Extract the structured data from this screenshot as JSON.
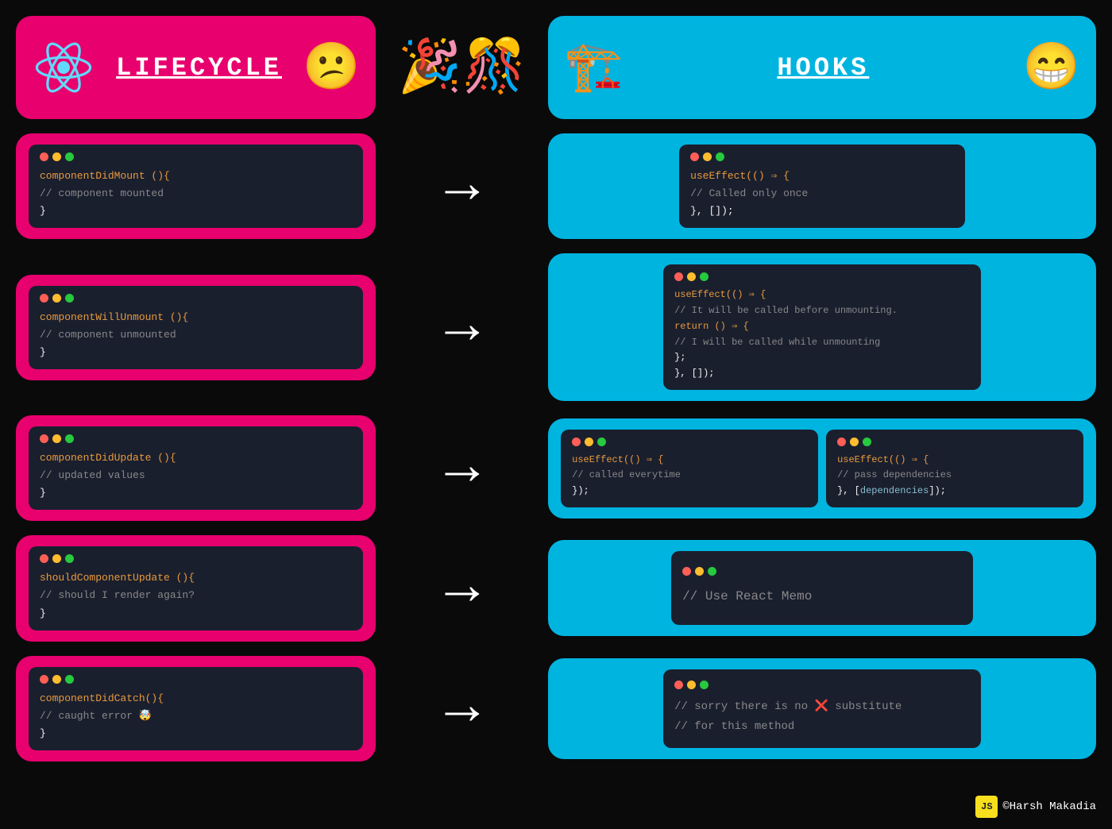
{
  "header": {
    "left": {
      "title": "LIFECYCLE",
      "emoji": "😕"
    },
    "right": {
      "title": "HOOKS",
      "emoji": "😁"
    }
  },
  "codeBlocks": {
    "left": [
      {
        "id": "componentDidMount",
        "lines": [
          {
            "type": "method",
            "text": "componentDidMount (){"
          },
          {
            "type": "comment",
            "text": "    // component mounted"
          },
          {
            "type": "plain",
            "text": "}"
          }
        ]
      },
      {
        "id": "componentWillUnmount",
        "lines": [
          {
            "type": "method",
            "text": "componentWillUnmount (){"
          },
          {
            "type": "comment",
            "text": "    // component unmounted"
          },
          {
            "type": "plain",
            "text": "}"
          }
        ]
      },
      {
        "id": "componentDidUpdate",
        "lines": [
          {
            "type": "method",
            "text": "componentDidUpdate (){"
          },
          {
            "type": "comment",
            "text": "    // updated values"
          },
          {
            "type": "plain",
            "text": "}"
          }
        ]
      },
      {
        "id": "shouldComponentUpdate",
        "lines": [
          {
            "type": "method",
            "text": "shouldComponentUpdate (){"
          },
          {
            "type": "comment",
            "text": "    // should I render again?"
          },
          {
            "type": "plain",
            "text": "}"
          }
        ]
      },
      {
        "id": "componentDidCatch",
        "lines": [
          {
            "type": "method",
            "text": "componentDidCatch(){"
          },
          {
            "type": "comment",
            "text": "    // caught error 🤯"
          },
          {
            "type": "plain",
            "text": "}"
          }
        ]
      }
    ],
    "right": [
      {
        "id": "useEffect-mount",
        "single": true,
        "lines": [
          {
            "type": "method",
            "text": "useEffect(() ⇒ {"
          },
          {
            "type": "comment",
            "text": "    // Called only once"
          },
          {
            "type": "plain",
            "text": "}, []);"
          }
        ]
      },
      {
        "id": "useEffect-unmount",
        "single": true,
        "lines": [
          {
            "type": "method",
            "text": "useEffect(() ⇒ {"
          },
          {
            "type": "comment",
            "text": "    // It will be called before unmounting."
          },
          {
            "type": "plain",
            "text": "    return () ⇒ {"
          },
          {
            "type": "comment",
            "text": "      // I will be called while unmounting"
          },
          {
            "type": "plain",
            "text": "    };"
          },
          {
            "type": "plain",
            "text": "}, []);"
          }
        ]
      },
      {
        "id": "useEffect-update",
        "single": false,
        "left_lines": [
          {
            "type": "method",
            "text": "useEffect(() ⇒ {"
          },
          {
            "type": "comment",
            "text": "    // called everytime"
          },
          {
            "type": "plain",
            "text": "});"
          }
        ],
        "right_lines": [
          {
            "type": "method",
            "text": "useEffect(() ⇒ {"
          },
          {
            "type": "comment",
            "text": "    // pass dependencies"
          },
          {
            "type": "plain",
            "text": "}, [dependencies]);"
          }
        ]
      },
      {
        "id": "react-memo",
        "single": true,
        "lines": [
          {
            "type": "comment",
            "text": "// Use React Memo"
          }
        ]
      },
      {
        "id": "no-substitute",
        "single": true,
        "lines": [
          {
            "type": "comment",
            "text": "// sorry there is no ❌ substitute"
          },
          {
            "type": "comment",
            "text": "// for this method"
          }
        ]
      }
    ]
  },
  "footer": {
    "badge": "JS",
    "author": "©Harsh Makadia"
  }
}
